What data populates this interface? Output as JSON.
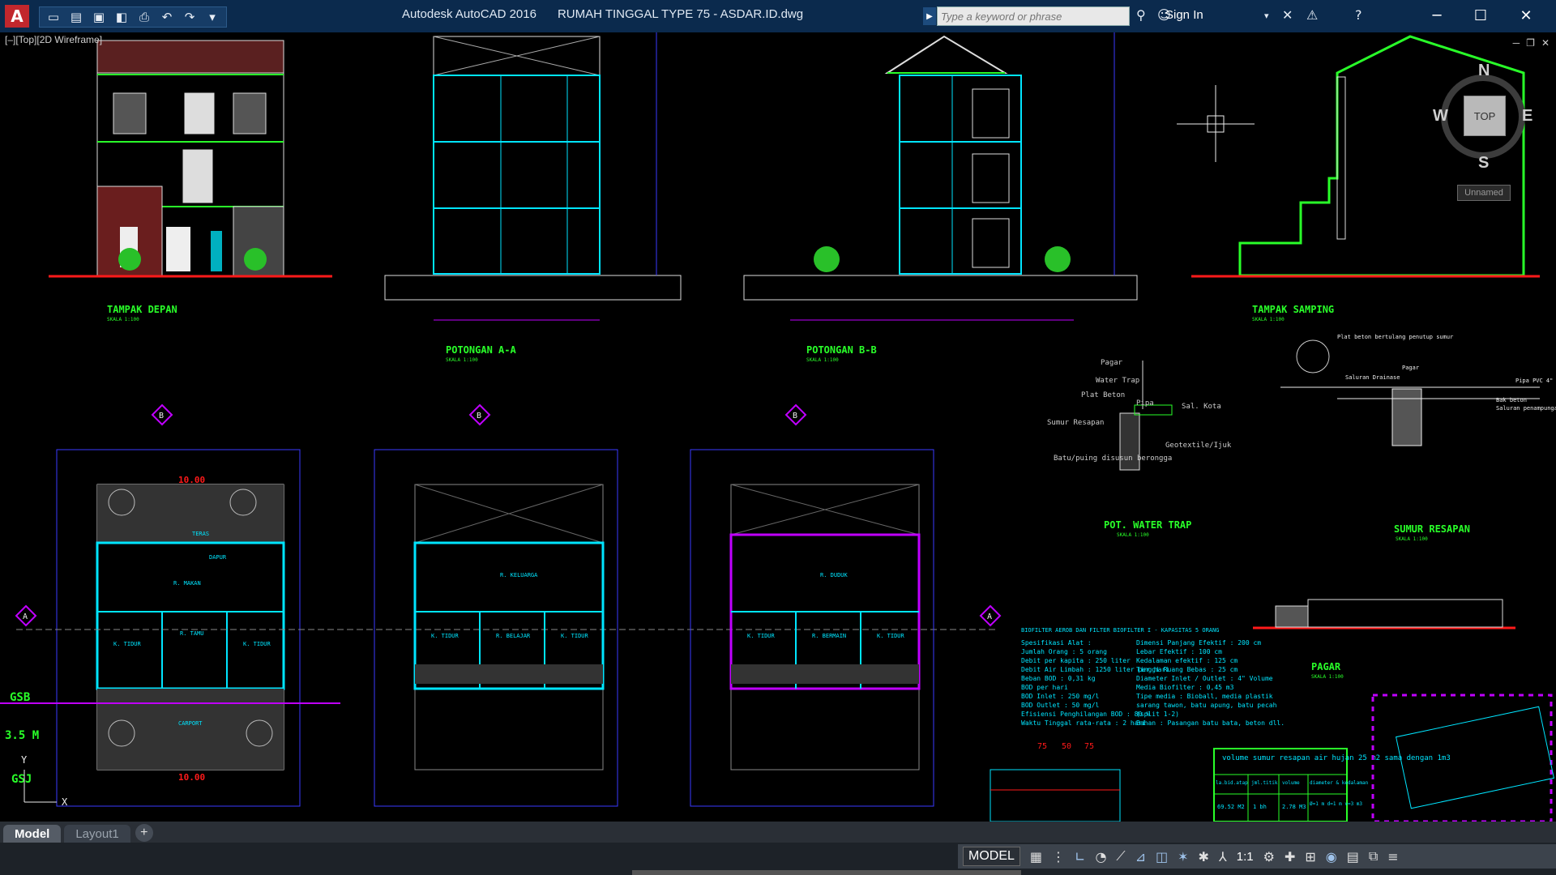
{
  "app": {
    "name": "Autodesk AutoCAD 2016",
    "file": "RUMAH TINGGAL TYPE 75 - ASDAR.ID.dwg",
    "logo_letter": "A"
  },
  "quick_access": [
    "new-icon",
    "open-icon",
    "save-icon",
    "saveas-icon",
    "print-icon",
    "undo-icon",
    "redo-icon",
    "dropdown-icon"
  ],
  "search": {
    "placeholder": "Type a keyword or phrase"
  },
  "signin": {
    "label": "Sign In"
  },
  "viewport": {
    "label": "[–][Top][2D Wireframe]"
  },
  "viewcube": {
    "north": "N",
    "south": "S",
    "east": "E",
    "west": "W",
    "face": "TOP",
    "ucs": "Unnamed"
  },
  "drawing": {
    "tampak_depan": "TAMPAK DEPAN",
    "potongan_aa": "POTONGAN A-A",
    "potongan_bb": "POTONGAN B-B",
    "tampak_samping": "TAMPAK SAMPING",
    "pot_water_trap": "POT. WATER TRAP",
    "sumur_resapan": "SUMUR RESAPAN",
    "pagar": "PAGAR",
    "skala": "SKALA 1:100",
    "gsb": "GSB",
    "gsb_dim": "3.5 M",
    "gsj": "GSJ",
    "dim_10": "10.00",
    "grid_a": "A",
    "grid_b": "B",
    "rooms": {
      "teras": "TERAS",
      "dapur": "DAPUR",
      "r_makan": "R. MAKAN",
      "r_tamu": "R. TAMU",
      "k_tidur": "K. TIDUR",
      "carport": "CARPORT",
      "r_keluarga": "R. KELUARGA",
      "r_belajar": "R. BELAJAR",
      "r_duduk": "R. DUDUK",
      "r_bermain": "R. BERMAIN",
      "kamar_mandi": "KM"
    },
    "water_trap_notes": [
      "Pagar",
      "Water Trap",
      "Plat Beton",
      "Pipa",
      "Sal. Kota",
      "Sumur Resapan",
      "Geotextile/Ijuk",
      "Batu/puing disusun berongga"
    ],
    "sumur_notes": [
      "Plat beton bertulang penutup sumur",
      "Saluran Drainase",
      "Pagar",
      "Pipa PVC 4\"",
      "Bak beton",
      "Saluran penampungan air hujan"
    ],
    "biofilter_title": "BIOFILTER AEROB DAN FILTER BIOFILTER I - KAPASITAS 5 ORANG",
    "biofilter_left": [
      "Spesifikasi Alat :",
      "Jumlah Orang : 5 orang",
      "Debit per kapita : 250 liter",
      "Debit Air Limbah : 1250 liter per hari",
      "Beban BOD : 0,31 kg",
      "BOD per hari",
      "BOD Inlet : 250 mg/l",
      "BOD Outlet : 50 mg/l",
      "Efisiensi Penghilangan BOD : 80 %",
      "Waktu Tinggal rata-rata : 2 hari"
    ],
    "biofilter_right": [
      "Dimensi Panjang Efektif : 200 cm",
      "Lebar Efektif : 100 cm",
      "Kedalaman efektif : 125 cm",
      "Tinggi Ruang Bebas : 25 cm",
      "Diameter Inlet / Outlet : 4\" Volume",
      "Media Biofilter : 0,45 m3",
      "Tipe media : Bioball, media plastik",
      "sarang tawon, batu apung, batu pecah",
      "(split 1-2)",
      "Bahan : Pasangan batu bata, beton dll."
    ],
    "table_title": "volume sumur resapan air hujan 25 m2 sama dengan 1m3",
    "table_headers": [
      "la.bid.atap",
      "jml.titik",
      "volume",
      "diameter & kedalaman"
    ],
    "table_row": [
      "69.52 M2",
      "1 bh",
      "2.78 M3",
      "Ø=1 m d=1 m v=3 m3"
    ],
    "dims_small": [
      "75",
      "50",
      "75"
    ]
  },
  "tabs": [
    {
      "label": "Model",
      "active": true
    },
    {
      "label": "Layout1",
      "active": false
    }
  ],
  "status": {
    "model": "MODEL",
    "scale": "1:1"
  },
  "colors": {
    "cyan": "#00e5ff",
    "green": "#29ff29",
    "red": "#ff1a1a",
    "magenta": "#c000ff",
    "blue": "#3a3aff",
    "white": "#f0f0f0",
    "yellow": "#ffff30"
  }
}
